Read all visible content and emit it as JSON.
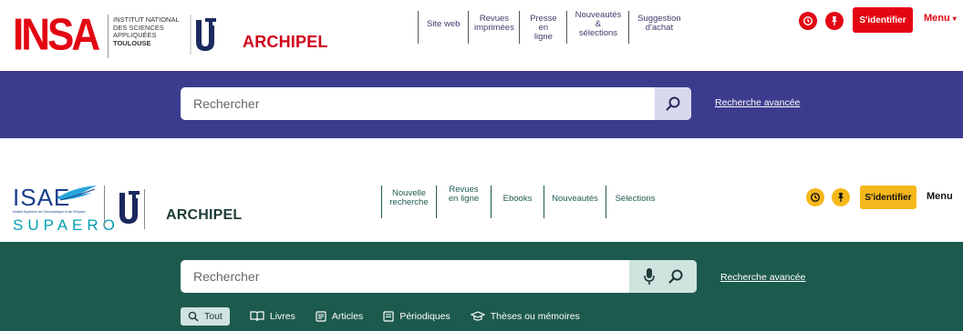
{
  "insa": {
    "logo_text": "INSA",
    "institute_lines": [
      "INSTITUT NATIONAL",
      "DES SCIENCES",
      "APPLIQUÉES",
      "TOULOUSE"
    ],
    "archipel": "ARCHIPEL",
    "nav": [
      {
        "label": "Site web"
      },
      {
        "label": "Revues imprimées"
      },
      {
        "label": "Presse en ligne"
      },
      {
        "label": "Nouveautés & sélections"
      },
      {
        "label": "Suggestion d'achat"
      }
    ],
    "history_icon": "history-icon",
    "pin_icon": "pin-icon",
    "login_label": "S'identifier",
    "menu_label": "Menu",
    "search_placeholder": "Rechercher",
    "advanced_search": "Recherche avancée",
    "colors": {
      "red": "#e30613",
      "band": "#3c3c8e",
      "search_btn": "#d8d8ee"
    }
  },
  "isae": {
    "logo_text": "ISAE",
    "logo_sub": "SUPAERO",
    "logo_tagline": "Institut Supérieur de l'Aéronautique et de l'Espace",
    "archipel": "ARCHIPEL",
    "nav": [
      {
        "label": "Nouvelle recherche"
      },
      {
        "label": "Revues en ligne"
      },
      {
        "label": "Ebooks"
      },
      {
        "label": "Nouveautés"
      },
      {
        "label": "Sélections"
      }
    ],
    "history_icon": "history-icon",
    "pin_icon": "pin-icon",
    "login_label": "S'identifier",
    "menu_label": "Menu",
    "search_placeholder": "Rechercher",
    "advanced_search": "Recherche avancée",
    "tabs": [
      {
        "label": "Tout",
        "icon": "search-icon",
        "active": true
      },
      {
        "label": "Livres",
        "icon": "book-icon",
        "active": false
      },
      {
        "label": "Articles",
        "icon": "article-icon",
        "active": false
      },
      {
        "label": "Périodiques",
        "icon": "periodical-icon",
        "active": false
      },
      {
        "label": "Thèses ou mémoires",
        "icon": "graduation-cap-icon",
        "active": false
      }
    ],
    "colors": {
      "yellow": "#f5b81c",
      "band": "#1d5a4e",
      "search_btn": "#cfe3df"
    }
  }
}
